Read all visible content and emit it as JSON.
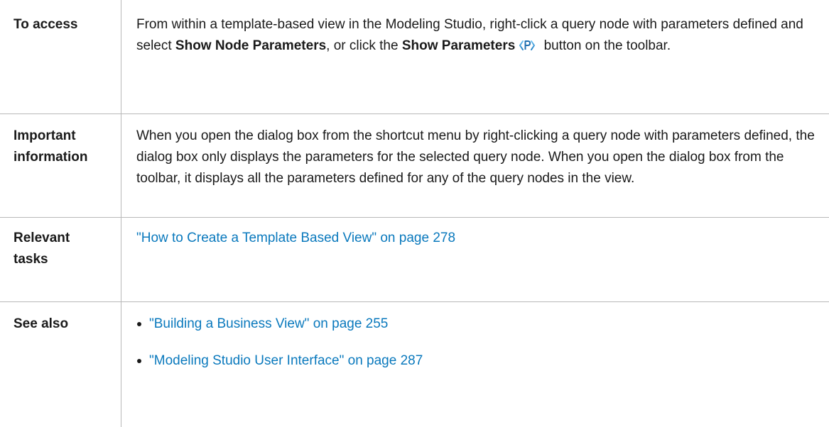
{
  "rows": {
    "access": {
      "label": "To access",
      "text_1": "From within a template-based view in the Modeling Studio, right-click a query node with parameters defined and select ",
      "bold_1": "Show Node Parameters",
      "text_2": ", or click the ",
      "bold_2": "Show Parameters",
      "icon": "show-parameters-icon",
      "text_3": " button on the toolbar."
    },
    "important": {
      "label_line1": "Important",
      "label_line2": "information",
      "text": "When you open the dialog box from the shortcut menu by right-clicking a query node with parameters defined, the dialog box only displays the parameters for the selected query node. When you open the dialog box from the toolbar, it displays all the parameters defined for any of the query nodes in the view."
    },
    "tasks": {
      "label_line1": "Relevant",
      "label_line2": "tasks",
      "link": "\"How to Create a Template Based View\" on page 278"
    },
    "see_also": {
      "label": "See also",
      "items": [
        "\"Building a Business View\" on page 255",
        "\"Modeling Studio User Interface\" on page 287"
      ]
    }
  },
  "colors": {
    "link": "#0a79bd",
    "border": "#b8b8b8",
    "text": "#1a1a1a"
  }
}
